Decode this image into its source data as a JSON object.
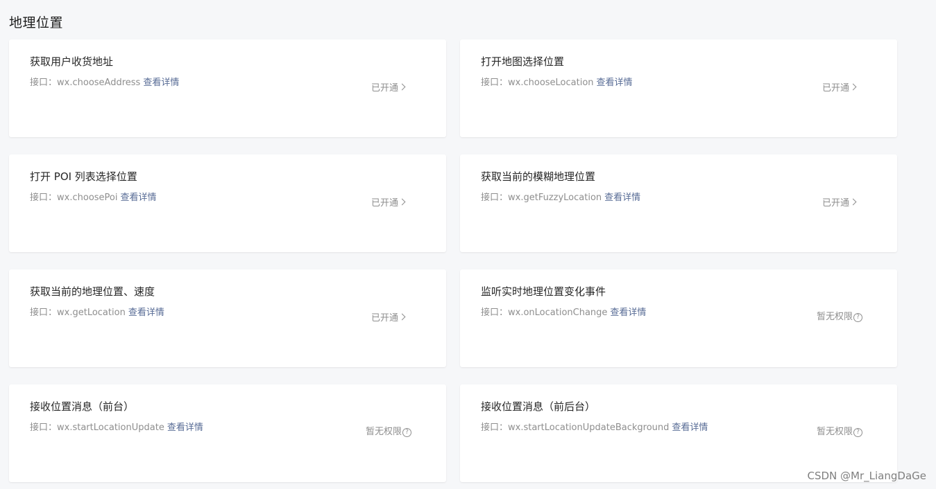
{
  "page": {
    "title": "地理位置"
  },
  "cards": [
    {
      "title": "获取用户收货地址",
      "api_prefix": "接口：",
      "api_name": "wx.chooseAddress",
      "detail": "查看详情",
      "status": "已开通",
      "status_type": "opened"
    },
    {
      "title": "打开地图选择位置",
      "api_prefix": "接口：",
      "api_name": "wx.chooseLocation",
      "detail": "查看详情",
      "status": "已开通",
      "status_type": "opened"
    },
    {
      "title": "打开 POI 列表选择位置",
      "api_prefix": "接口：",
      "api_name": "wx.choosePoi",
      "detail": "查看详情",
      "status": "已开通",
      "status_type": "opened"
    },
    {
      "title": "获取当前的模糊地理位置",
      "api_prefix": "接口：",
      "api_name": "wx.getFuzzyLocation",
      "detail": "查看详情",
      "status": "已开通",
      "status_type": "opened"
    },
    {
      "title": "获取当前的地理位置、速度",
      "api_prefix": "接口：",
      "api_name": "wx.getLocation",
      "detail": "查看详情",
      "status": "已开通",
      "status_type": "opened"
    },
    {
      "title": "监听实时地理位置变化事件",
      "api_prefix": "接口：",
      "api_name": "wx.onLocationChange",
      "detail": "查看详情",
      "status": "暂无权限",
      "status_type": "noperm"
    },
    {
      "title": "接收位置消息（前台）",
      "api_prefix": "接口：",
      "api_name": "wx.startLocationUpdate",
      "detail": "查看详情",
      "status": "暂无权限",
      "status_type": "noperm"
    },
    {
      "title": "接收位置消息（前后台）",
      "api_prefix": "接口：",
      "api_name": "wx.startLocationUpdateBackground",
      "detail": "查看详情",
      "status": "暂无权限",
      "status_type": "noperm"
    }
  ],
  "icons": {
    "opened": "chevron-right-icon",
    "noperm": "question-circle-icon"
  },
  "help_glyph": "?",
  "watermark": "CSDN @Mr_LiangDaGe",
  "colors": {
    "background": "#f6f7f9",
    "card": "#ffffff",
    "link": "#576b95",
    "muted_text": "#8e8e8e",
    "title_text": "#262626"
  }
}
